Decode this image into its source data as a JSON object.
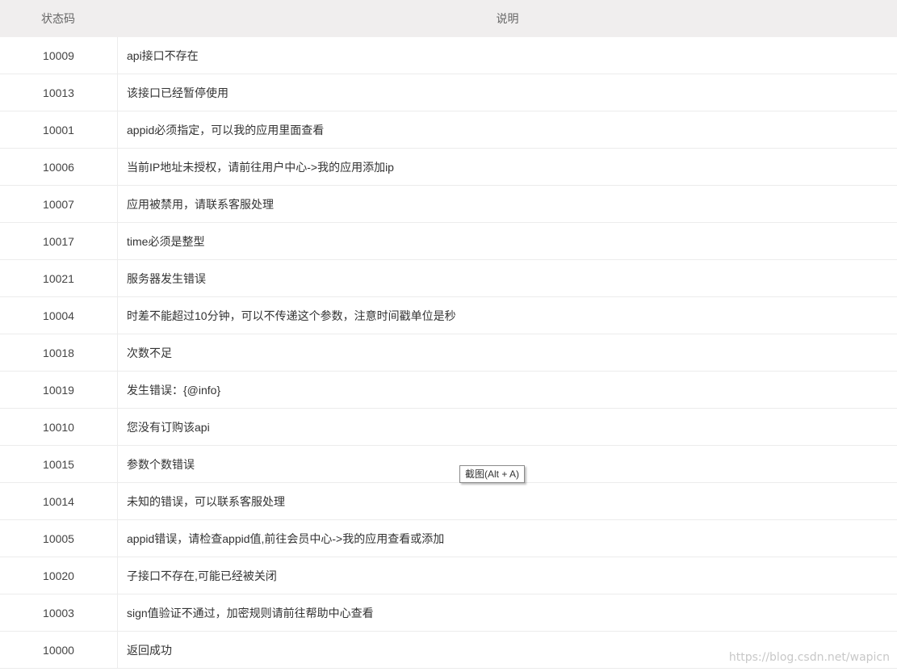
{
  "header": {
    "code_label": "状态码",
    "desc_label": "说明"
  },
  "rows": [
    {
      "code": "10009",
      "desc": "api接口不存在"
    },
    {
      "code": "10013",
      "desc": "该接口已经暂停使用"
    },
    {
      "code": "10001",
      "desc": "appid必须指定，可以我的应用里面查看"
    },
    {
      "code": "10006",
      "desc": "当前IP地址未授权，请前往用户中心->我的应用添加ip"
    },
    {
      "code": "10007",
      "desc": "应用被禁用，请联系客服处理"
    },
    {
      "code": "10017",
      "desc": "time必须是整型"
    },
    {
      "code": "10021",
      "desc": "服务器发生错误"
    },
    {
      "code": "10004",
      "desc": "时差不能超过10分钟，可以不传递这个参数，注意时间戳单位是秒"
    },
    {
      "code": "10018",
      "desc": "次数不足"
    },
    {
      "code": "10019",
      "desc": "发生错误：{@info}"
    },
    {
      "code": "10010",
      "desc": "您没有订购该api"
    },
    {
      "code": "10015",
      "desc": "参数个数错误"
    },
    {
      "code": "10014",
      "desc": "未知的错误，可以联系客服处理"
    },
    {
      "code": "10005",
      "desc": "appid错误，请检查appid值,前往会员中心->我的应用查看或添加"
    },
    {
      "code": "10020",
      "desc": "子接口不存在,可能已经被关闭"
    },
    {
      "code": "10003",
      "desc": "sign值验证不通过，加密规则请前往帮助中心查看"
    },
    {
      "code": "10000",
      "desc": "返回成功"
    }
  ],
  "tooltip": {
    "text": "截图(Alt + A)"
  },
  "watermark": {
    "text": "https://blog.csdn.net/wapicn"
  }
}
